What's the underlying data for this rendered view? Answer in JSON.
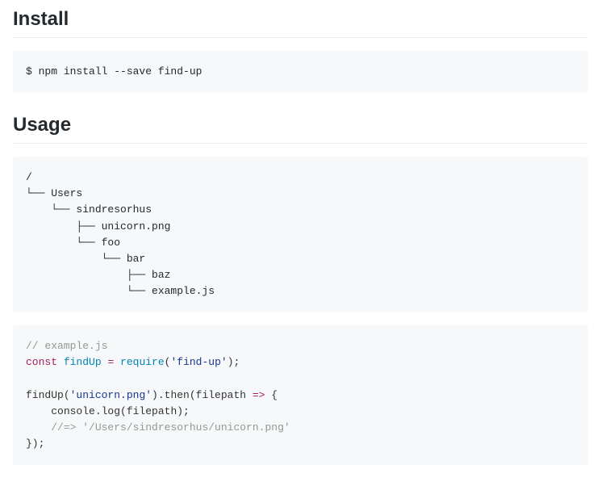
{
  "install": {
    "heading": "Install",
    "command": "$ npm install --save find-up"
  },
  "usage": {
    "heading": "Usage",
    "tree": "/\n└── Users\n    └── sindresorhus\n        ├── unicorn.png\n        └── foo\n            └── bar\n                ├── baz\n                └── example.js",
    "example": {
      "comment1": "// example.js",
      "kw_const": "const",
      "id_findUp": "findUp",
      "op_eq": " = ",
      "fn_require": "require",
      "paren_open": "(",
      "str_findup": "'find-up'",
      "paren_close_semi": ");",
      "call_findUp": "findUp",
      "str_unicorn": "'unicorn.png'",
      "then": ").then(filepath ",
      "arrow": "=>",
      "brace_open": " {",
      "indent": "    ",
      "console_log": "console.log(filepath);",
      "comment2": "//=> '/Users/sindresorhus/unicorn.png'",
      "close": "});"
    }
  }
}
